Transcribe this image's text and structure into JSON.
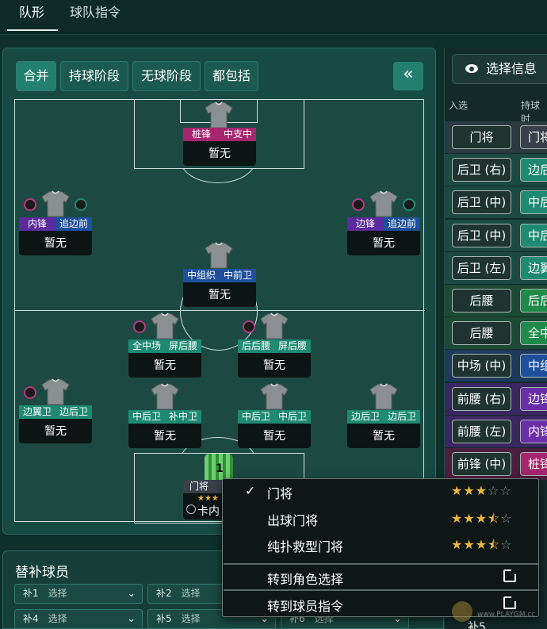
{
  "top_tabs": [
    "队形",
    "球队指令"
  ],
  "segments": [
    "合并",
    "持球阶段",
    "无球阶段",
    "都包括"
  ],
  "collapse_label": "«",
  "players": {
    "st": {
      "roles": [
        "桩锋",
        "中支中"
      ],
      "name": "暂无"
    },
    "lw": {
      "roles": [
        "内锋",
        "追边前"
      ],
      "name": "暂无"
    },
    "rw": {
      "roles": [
        "边锋",
        "追边前"
      ],
      "name": "暂无"
    },
    "am": {
      "roles": [
        "中组织",
        "中前卫"
      ],
      "name": "暂无"
    },
    "cm_l": {
      "roles": [
        "全中场",
        "屏后腰"
      ],
      "name": "暂无"
    },
    "cm_r": {
      "roles": [
        "后后腰",
        "屏后腰"
      ],
      "name": "暂无"
    },
    "lb": {
      "roles": [
        "边翼卫",
        "边后卫"
      ],
      "name": "暂无"
    },
    "cb_l": {
      "roles": [
        "中后卫",
        "补中卫"
      ],
      "name": "暂无"
    },
    "cb_r": {
      "roles": [
        "中后卫",
        "中后卫"
      ],
      "name": "暂无"
    },
    "rb": {
      "roles": [
        "边后卫",
        "边后卫"
      ],
      "name": "暂无"
    },
    "gk": {
      "roles": [
        "门将"
      ],
      "name": "卡内",
      "number": "1",
      "stars": "★★★"
    }
  },
  "right_panel": {
    "eye_label": "选择信息",
    "col_selected": "入选",
    "col_inpossession": "持球时",
    "rows": [
      {
        "pos": "门将",
        "role": "门将"
      },
      {
        "pos": "后卫 (右)",
        "role": "边后"
      },
      {
        "pos": "后卫 (中)",
        "role": "中后"
      },
      {
        "pos": "后卫 (中)",
        "role": "中后"
      },
      {
        "pos": "后卫 (左)",
        "role": "边翼"
      },
      {
        "pos": "后腰",
        "role": "后后"
      },
      {
        "pos": "后腰",
        "role": "全中"
      },
      {
        "pos": "中场 (中)",
        "role": "中组"
      },
      {
        "pos": "前腰 (右)",
        "role": "边锋"
      },
      {
        "pos": "前腰 (左)",
        "role": "内锋"
      },
      {
        "pos": "前锋 (中)",
        "role": "桩锋"
      }
    ],
    "bottom_label": "补5"
  },
  "subs": {
    "title": "替补球员",
    "slots": [
      {
        "label": "补1",
        "placeholder": "选择"
      },
      {
        "label": "补2",
        "placeholder": "选择"
      },
      {
        "label": "补4",
        "placeholder": "选择"
      },
      {
        "label": "补5",
        "placeholder": "选择"
      },
      {
        "label": "补6",
        "placeholder": "选择"
      }
    ]
  },
  "dropdown": {
    "items": [
      {
        "label": "门将",
        "checked": true,
        "stars": "★★★☆☆",
        "rating": 3
      },
      {
        "label": "出球门将",
        "checked": false,
        "stars": "★★★⯪☆",
        "rating": 3.5
      },
      {
        "label": "纯扑救型门将",
        "checked": false,
        "stars": "★★★⯪☆",
        "rating": 3.5
      }
    ],
    "links": [
      "转到角色选择",
      "转到球员指令"
    ],
    "check_glyph": "✓"
  },
  "colors": {
    "pitch": "#1c4a43",
    "attack_role": "#a5266e",
    "wing_role": "#5b2a9c",
    "mid_role": "#1e4f9c",
    "def_role": "#1e8a72",
    "gk_role": "#3a3f4a",
    "star": "#f0b73a"
  },
  "watermark": "www.PLAYGM.cc"
}
